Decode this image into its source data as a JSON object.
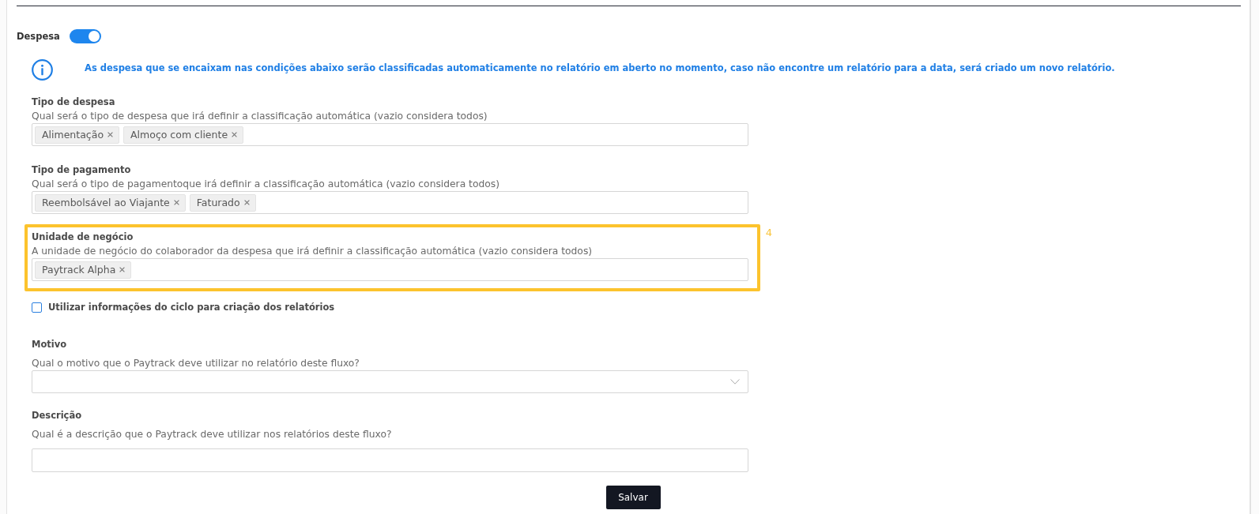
{
  "section": {
    "title": "Despesa",
    "toggle": {
      "on": true
    }
  },
  "info": {
    "text": "As despesa que se encaixam nas condições abaixo serão classificadas automaticamente no relatório em aberto no momento, caso não encontre um relatório para a data, será criado um novo relatório."
  },
  "filters": [
    {
      "label": "Tipo de despesa",
      "help": "Qual será o tipo de despesa que irá definir a classificação automática (vazio considera todos)",
      "tags": [
        "Alimentação",
        "Almoço com cliente"
      ],
      "highlighted": false
    },
    {
      "label": "Tipo de pagamento",
      "help": "Qual será o tipo de pagamentoque irá definir a classificação automática (vazio considera todos)",
      "tags": [
        "Reembolsável ao Viajante",
        "Faturado"
      ],
      "highlighted": false
    },
    {
      "label": "Unidade de negócio",
      "help": "A unidade de negócio do colaborador da despesa que irá definir a classificação automática (vazio considera todos)",
      "tags": [
        "Paytrack Alpha"
      ],
      "highlighted": true,
      "callout": "4"
    }
  ],
  "cycle_option": {
    "label": "Utilizar informações do ciclo para criação dos relatórios",
    "checked": false
  },
  "fields": [
    {
      "kind": "select",
      "label": "Motivo",
      "help": "Qual o motivo que o Paytrack deve utilizar no relatório deste fluxo?"
    },
    {
      "kind": "text",
      "label": "Descrição",
      "help": "Qual é a descrição que o Paytrack deve utilizar nos relatórios deste fluxo?"
    }
  ],
  "save_button": {
    "label": "Salvar"
  }
}
